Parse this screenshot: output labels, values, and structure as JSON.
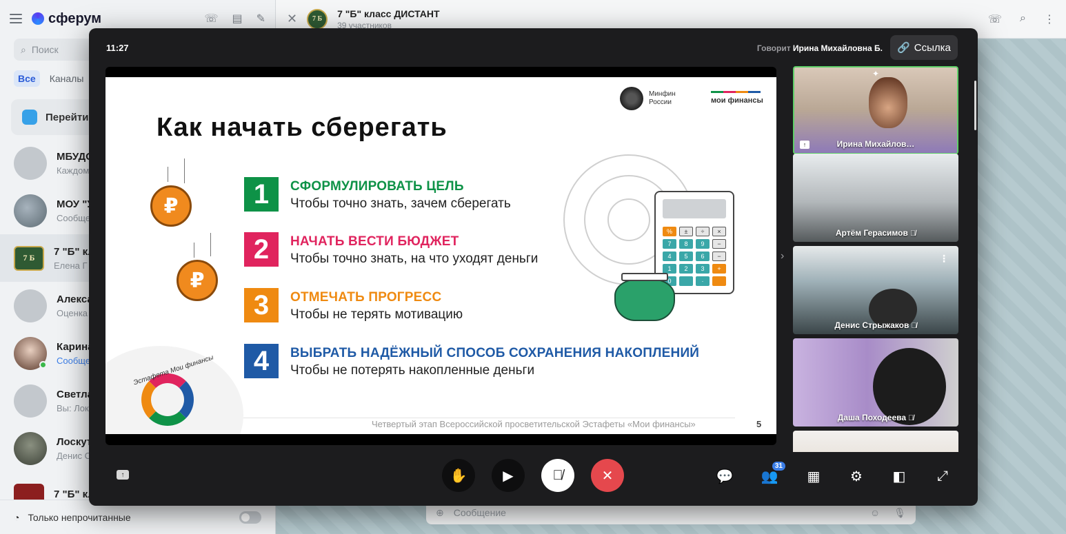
{
  "app": {
    "logo": "сферум",
    "search_placeholder": "Поиск",
    "tabs": [
      "Все",
      "Каналы"
    ],
    "goto_label": "Перейти",
    "chats": [
      {
        "name": "МБУДО",
        "msg": "Каждом"
      },
      {
        "name": "МОУ \"У",
        "msg": "Сообще"
      },
      {
        "name": "7 \"Б\" кл",
        "msg": "Елена Г",
        "avatar_text": "7 Б"
      },
      {
        "name": "Алекса",
        "msg": "Оценка"
      },
      {
        "name": "Карина",
        "msg": "Сообще"
      },
      {
        "name": "Светла",
        "msg": "Вы: Лок"
      },
      {
        "name": "Лоскут",
        "msg": "Денис С"
      },
      {
        "name": "7 \"Б\" кл",
        "msg": ""
      }
    ],
    "unread_only_label": "Только непрочитанные",
    "channel": {
      "title": "7 \"Б\" класс ДИСТАНТ",
      "subtitle": "39 участников",
      "avatar_text": "7 Б"
    },
    "composer_placeholder": "Сообщение"
  },
  "call": {
    "time": "11:27",
    "speaking_prefix": "Говорит",
    "speaker": "Ирина Михайловна Б.",
    "link_label": "Ссылка",
    "participants_badge": "31",
    "tiles": [
      {
        "name": "Ирина Михайлов…",
        "muted": false
      },
      {
        "name": "Артём Герасимов",
        "muted": true
      },
      {
        "name": "Денис Стрыжаков",
        "muted": true
      },
      {
        "name": "Даша Походеева",
        "muted": true
      }
    ]
  },
  "slide": {
    "title": "Как начать сберегать",
    "logo_minfin": [
      "Минфин",
      "России"
    ],
    "logo_moi": "мои финансы",
    "steps": [
      {
        "num": "1",
        "head": "СФОРМУЛИРОВАТЬ ЦЕЛЬ",
        "desc": "Чтобы точно знать, зачем сберегать"
      },
      {
        "num": "2",
        "head": "НАЧАТЬ ВЕСТИ БЮДЖЕТ",
        "desc": "Чтобы точно знать, на что уходят деньги"
      },
      {
        "num": "3",
        "head": "ОТМЕЧАТЬ ПРОГРЕСС",
        "desc": "Чтобы не терять мотивацию"
      },
      {
        "num": "4",
        "head": "ВЫБРАТЬ НАДЁЖНЫЙ СПОСОБ СОХРАНЕНИЯ НАКОПЛЕНИЙ",
        "desc": "Чтобы не потерять накопленные деньги"
      }
    ],
    "footer": "Четвертый этап Всероссийской просветительской Эстафеты «Мои финансы»",
    "page": "5",
    "estafeta": "Эстафета Мои финансы",
    "coin_symbol": "₽",
    "calc_keys": [
      "%",
      "±",
      "÷",
      "×",
      "7",
      "8",
      "9",
      "−",
      "4",
      "5",
      "6",
      "−",
      "1",
      "2",
      "3",
      "+",
      "0",
      "",
      "·",
      ""
    ]
  },
  "colors": {
    "step1": "#0e9247",
    "step2": "#e0245e",
    "step3": "#ef8a11",
    "step4": "#1f5aa6",
    "hangup": "#e5484d",
    "active_tile": "#5fd068"
  }
}
